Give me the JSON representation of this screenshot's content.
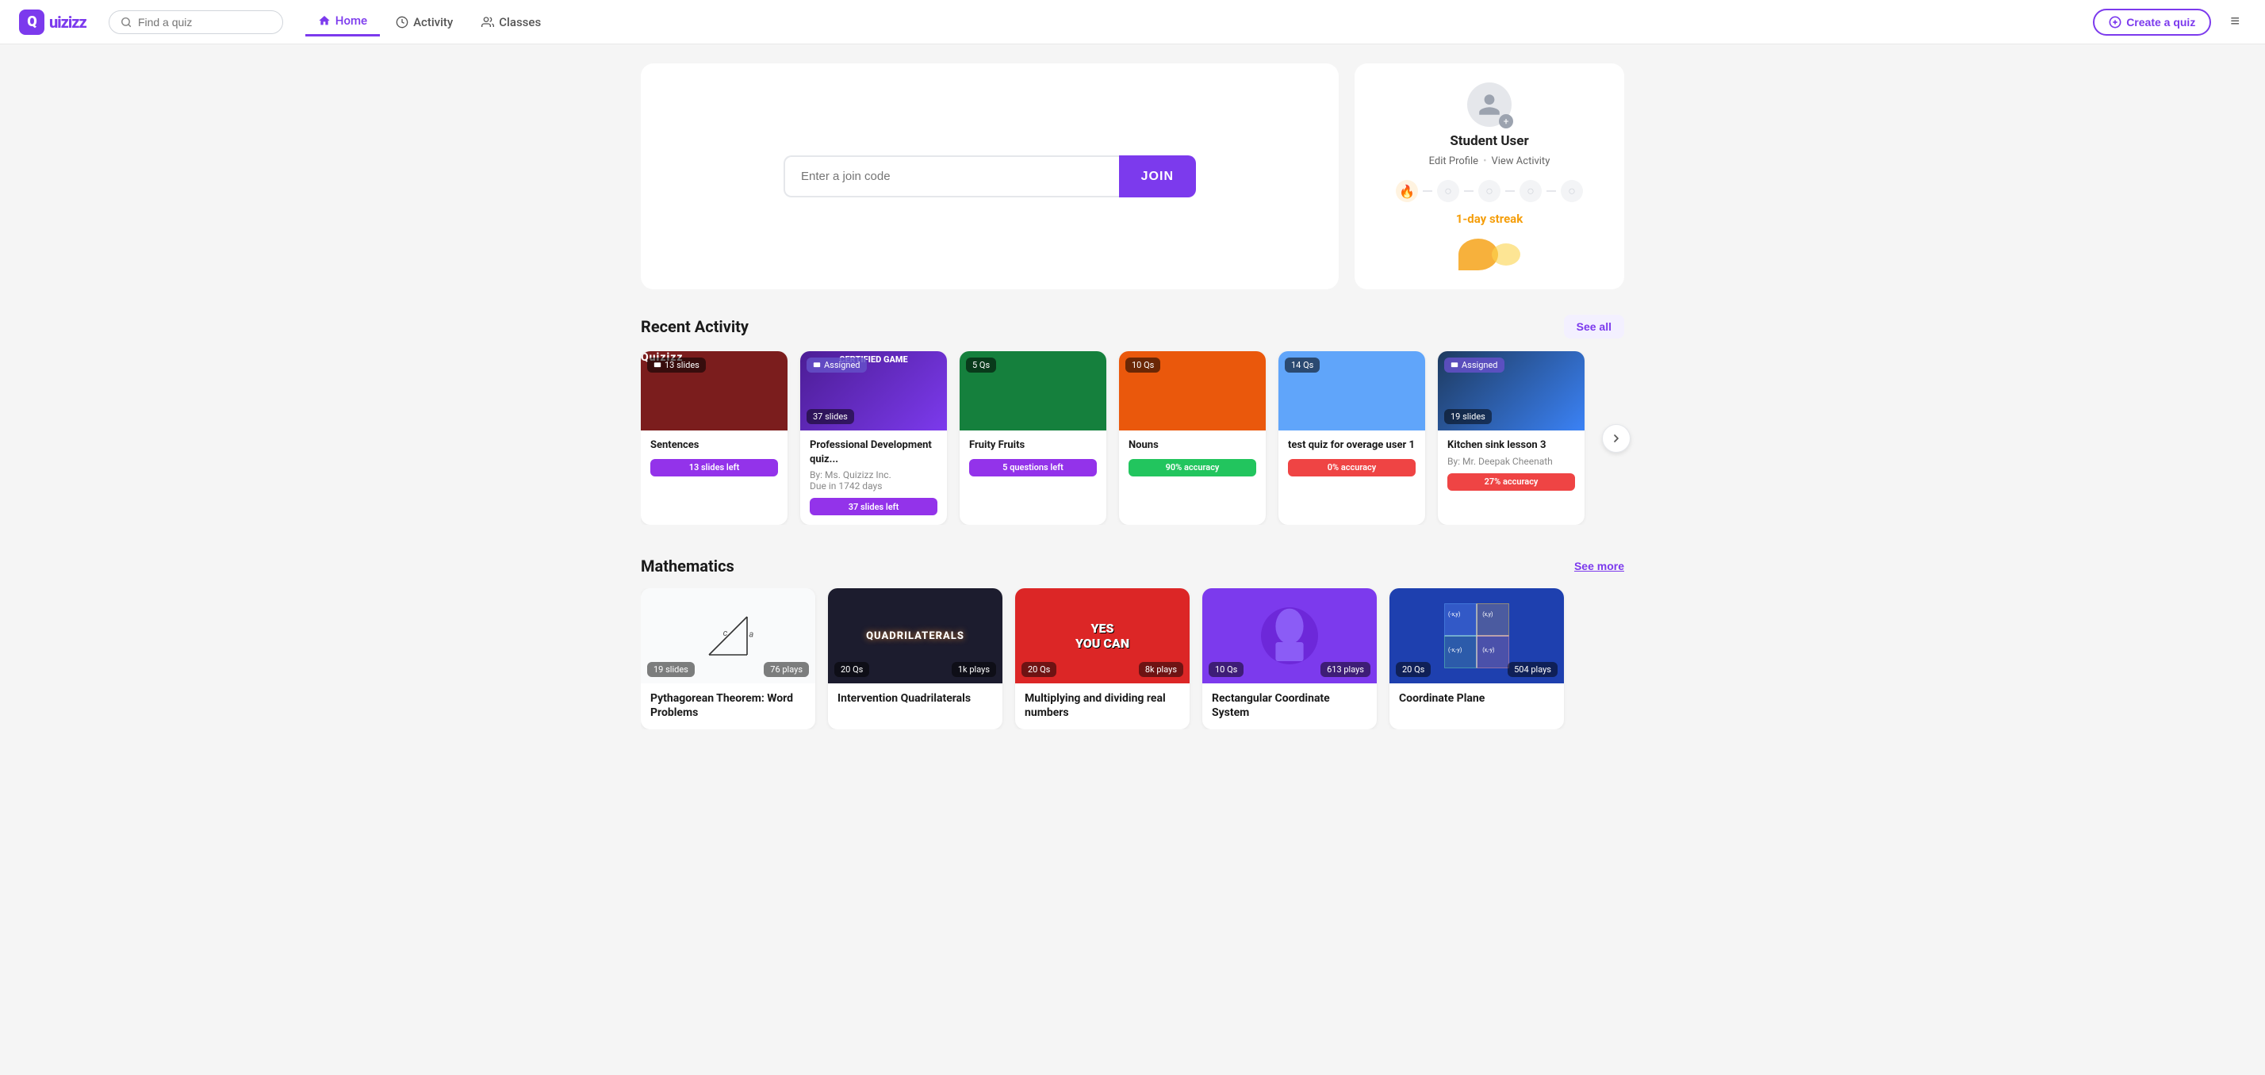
{
  "logo": {
    "text": "Quizizz",
    "icon_letter": "Q"
  },
  "navbar": {
    "search_placeholder": "Find a quiz",
    "links": [
      {
        "id": "home",
        "label": "Home",
        "active": true,
        "icon": "home-icon"
      },
      {
        "id": "activity",
        "label": "Activity",
        "active": false,
        "icon": "clock-icon"
      },
      {
        "id": "classes",
        "label": "Classes",
        "active": false,
        "icon": "users-icon"
      }
    ],
    "create_label": "Create a quiz",
    "menu_icon": "≡"
  },
  "join_section": {
    "placeholder": "Enter a join code",
    "button_label": "JOIN"
  },
  "profile": {
    "name": "Student User",
    "edit_label": "Edit Profile",
    "view_label": "View Activity",
    "separator": "•",
    "streak_label": "1-day streak",
    "streak_dots": [
      {
        "active": true,
        "icon": "🔥"
      },
      {
        "active": false,
        "icon": "○"
      },
      {
        "active": false,
        "icon": "○"
      },
      {
        "active": false,
        "icon": "○"
      },
      {
        "active": false,
        "icon": "○"
      }
    ]
  },
  "recent_activity": {
    "title": "Recent Activity",
    "see_all_label": "See all",
    "cards": [
      {
        "id": "sentences",
        "title": "Sentences",
        "badge": "13 slides",
        "badge_type": "slides",
        "assigned": false,
        "progress_label": "13 slides left",
        "progress_type": "slides",
        "bg_color": "#7b1d1d",
        "thumb_text": "Quizizz"
      },
      {
        "id": "professional-dev",
        "title": "Professional Development quiz...",
        "badge": "37 slides",
        "badge_type": "slides",
        "assigned": true,
        "assigned_label": "Assigned",
        "meta_by": "By: Ms. Quizizz Inc.",
        "meta_due": "Due in 1742 days",
        "progress_label": "37 slides left",
        "progress_type": "slides",
        "bg_color": "#4c1d95",
        "thumb_text": "CERTIFIED GAME"
      },
      {
        "id": "fruity-fruits",
        "title": "Fruity Fruits",
        "badge": "5 Qs",
        "badge_type": "questions",
        "assigned": false,
        "progress_label": "5 questions left",
        "progress_type": "questions",
        "bg_color": "#15803d",
        "thumb_text": ""
      },
      {
        "id": "nouns",
        "title": "Nouns",
        "badge": "10 Qs",
        "badge_type": "questions",
        "assigned": false,
        "progress_label": "90% accuracy",
        "progress_type": "accuracy-green",
        "bg_color": "#ea580c",
        "thumb_text": ""
      },
      {
        "id": "test-quiz",
        "title": "test quiz for overage user 1",
        "badge": "14 Qs",
        "badge_type": "questions",
        "assigned": false,
        "meta_by": "",
        "progress_label": "0% accuracy",
        "progress_type": "accuracy-red",
        "bg_color": "#60a5fa",
        "thumb_text": ""
      },
      {
        "id": "kitchen-sink",
        "title": "Kitchen sink lesson 3",
        "badge": "19 slides",
        "badge_type": "slides",
        "assigned": true,
        "assigned_label": "Assigned",
        "meta_by": "By: Mr. Deepak Cheenath",
        "progress_label": "27% accuracy",
        "progress_type": "accuracy-red",
        "bg_color": "#1e3a5f",
        "thumb_text": ""
      }
    ]
  },
  "mathematics": {
    "title": "Mathematics",
    "see_more_label": "See more",
    "cards": [
      {
        "id": "pythagorean",
        "title": "Pythagorean Theorem: Word Problems",
        "slides_label": "19 slides",
        "plays_label": "76 plays",
        "bg_color": "#f9fafb",
        "thumb_text": "c / a"
      },
      {
        "id": "quadrilaterals",
        "title": "Intervention Quadrilaterals",
        "qs_label": "20 Qs",
        "plays_label": "1k plays",
        "bg_color": "#1c1c2e",
        "thumb_text": "QUADRILATERALS"
      },
      {
        "id": "multiplying",
        "title": "Multiplying and dividing real numbers",
        "qs_label": "20 Qs",
        "plays_label": "8k plays",
        "bg_color": "#dc2626",
        "thumb_text": "YES YOU CAN"
      },
      {
        "id": "rectangular-coordinate",
        "title": "Rectangular Coordinate System",
        "qs_label": "10 Qs",
        "plays_label": "613 plays",
        "bg_color": "#7c3aed",
        "thumb_text": ""
      },
      {
        "id": "coordinate-plane",
        "title": "Coordinate Plane",
        "qs_label": "20 Qs",
        "plays_label": "504 plays",
        "bg_color": "#1e40af",
        "thumb_text": "(-x,y) (x,y)"
      }
    ]
  }
}
